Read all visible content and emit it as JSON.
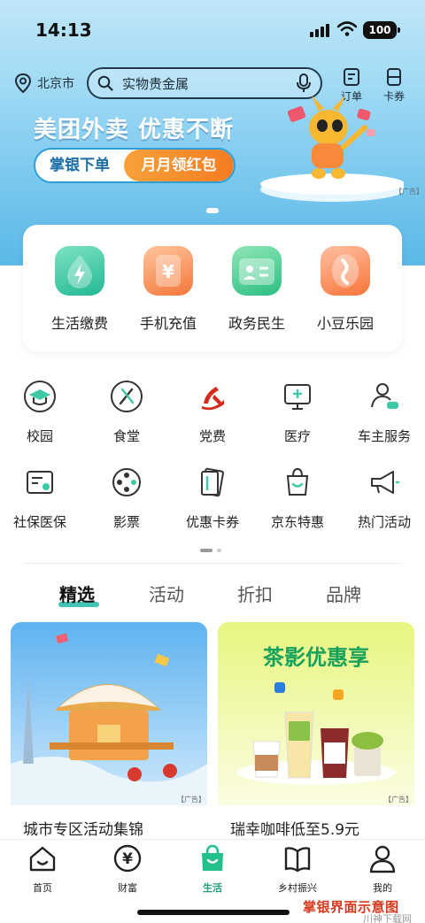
{
  "status_bar": {
    "time": "14:13",
    "battery": "100"
  },
  "header": {
    "location": "北京市",
    "search_text": "实物贵金属",
    "orders_label": "订单",
    "cards_label": "卡券"
  },
  "banner": {
    "title": "美团外卖 优惠不断",
    "pill_left": "掌银下单",
    "pill_right": "月月领红包",
    "ad_tag": "【广告】"
  },
  "quick_services": [
    {
      "label": "生活缴费",
      "icon": "lightning-drop-icon",
      "color": "#29c29a"
    },
    {
      "label": "手机充值",
      "icon": "yen-card-icon",
      "color": "#f7813a"
    },
    {
      "label": "政务民生",
      "icon": "id-card-icon",
      "color": "#2cbf83"
    },
    {
      "label": "小豆乐园",
      "icon": "bean-icon",
      "color": "#f77a3a"
    }
  ],
  "services": [
    {
      "label": "校园",
      "icon": "graduation-cap-icon"
    },
    {
      "label": "食堂",
      "icon": "utensils-icon"
    },
    {
      "label": "党费",
      "icon": "party-emblem-icon"
    },
    {
      "label": "医疗",
      "icon": "medical-monitor-icon"
    },
    {
      "label": "车主服务",
      "icon": "driver-car-icon"
    },
    {
      "label": "社保医保",
      "icon": "insurance-card-icon"
    },
    {
      "label": "影票",
      "icon": "film-reel-icon"
    },
    {
      "label": "优惠卡券",
      "icon": "coupon-cards-icon"
    },
    {
      "label": "京东特惠",
      "icon": "shopping-bag-icon"
    },
    {
      "label": "热门活动",
      "icon": "megaphone-icon"
    }
  ],
  "tabs": [
    "精选",
    "活动",
    "折扣",
    "品牌"
  ],
  "feed": [
    {
      "title": "城市专区活动集锦",
      "ad": "【广告】"
    },
    {
      "title": "瑞幸咖啡低至5.9元",
      "ad": "【广告】",
      "image_text": "茶影优惠享"
    }
  ],
  "bottom_nav": [
    {
      "label": "首页",
      "icon": "home-icon"
    },
    {
      "label": "财富",
      "icon": "yen-coin-icon"
    },
    {
      "label": "生活",
      "icon": "shopping-bag-icon"
    },
    {
      "label": "乡村振兴",
      "icon": "book-icon"
    },
    {
      "label": "我的",
      "icon": "user-icon"
    }
  ],
  "caption": "掌银界面示意图",
  "watermark": "川神下载网"
}
